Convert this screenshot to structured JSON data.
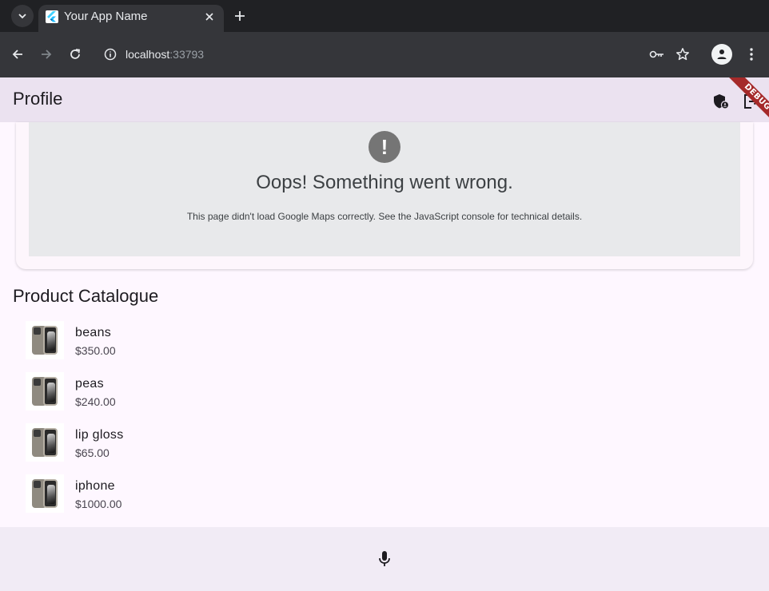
{
  "browser": {
    "tab_title": "Your App Name",
    "url_host": "localhost",
    "url_port": ":33793"
  },
  "app": {
    "title": "Profile",
    "debug_banner": "DEBUG"
  },
  "map_error": {
    "icon": "!",
    "title": "Oops! Something went wrong.",
    "message": "This page didn't load Google Maps correctly. See the JavaScript console for technical details."
  },
  "catalogue": {
    "title": "Product Catalogue",
    "products": [
      {
        "name": "beans",
        "price": "$350.00"
      },
      {
        "name": "peas",
        "price": "$240.00"
      },
      {
        "name": "lip gloss",
        "price": "$65.00"
      },
      {
        "name": "iphone",
        "price": "$1000.00"
      }
    ]
  },
  "icons": {
    "tab_search": "chevron-down-icon",
    "favicon": "flutter-icon",
    "tab_close": "close-icon",
    "new_tab": "plus-icon",
    "back": "arrow-left-icon",
    "forward": "arrow-right-icon",
    "reload": "reload-icon",
    "site_info": "info-icon",
    "password": "key-icon",
    "bookmark": "star-icon",
    "profile": "person-icon",
    "menu": "kebab-menu-icon",
    "admin": "shield-icon",
    "logout": "logout-icon",
    "mic": "microphone-icon"
  },
  "colors": {
    "appbar": "#ebe2f0",
    "background": "#fef7ff",
    "debug_ribbon": "#a52a2a",
    "error_bg": "#e8e9eb"
  }
}
